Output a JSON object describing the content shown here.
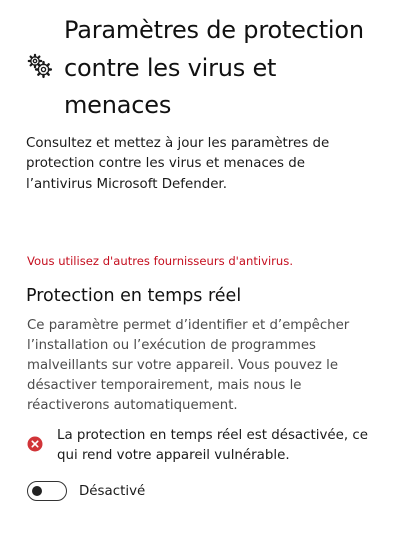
{
  "header": {
    "icon": "gears-icon",
    "title": "Paramètres de protection contre les virus et menaces"
  },
  "description": "Consultez et mettez à jour les paramètres de protection contre les virus et menaces de l’antivirus Microsoft Defender.",
  "warning": {
    "text": "Vous utilisez d'autres fournisseurs d'antivirus.",
    "color": "#c50f1f"
  },
  "realtime": {
    "title": "Protection en temps réel",
    "description": "Ce paramètre permet d’identifier et d’empêcher l’installation ou l’exécution de programmes malveillants sur votre appareil. Vous pouvez le désactiver temporairement, mais nous le réactiverons automatiquement.",
    "status": {
      "icon": "error-icon",
      "color": "#d13438",
      "text": "La protection en temps réel est désactivée, ce qui rend votre appareil vulnérable."
    },
    "toggle": {
      "state": "off",
      "label": "Désactivé"
    }
  }
}
